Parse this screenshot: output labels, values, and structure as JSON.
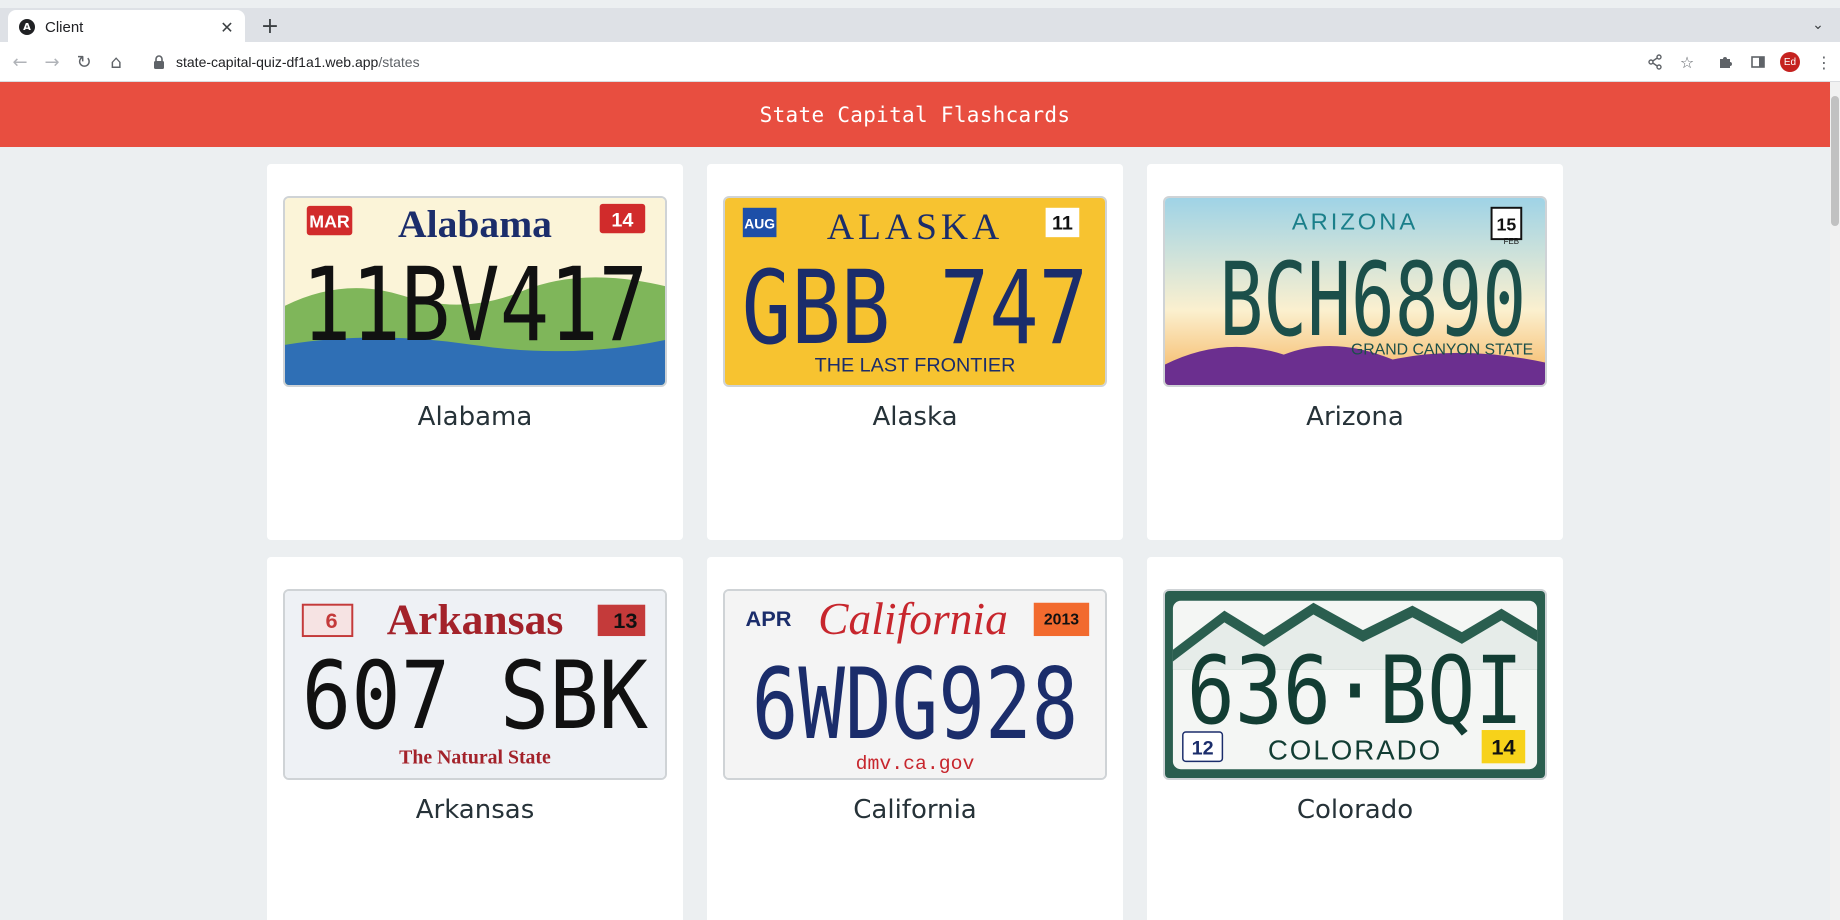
{
  "browser": {
    "tab_title": "Client",
    "url_host": "state-capital-quiz-df1a1.web.app",
    "url_path": "/states",
    "profile_initials": "Ed"
  },
  "app": {
    "title": "State Capital Flashcards",
    "accent_color": "#e84e40"
  },
  "states": [
    {
      "name": "Alabama",
      "plate": {
        "header": "Alabama",
        "number": "11BV417",
        "month": "MAR",
        "year": "14",
        "footer": ""
      }
    },
    {
      "name": "Alaska",
      "plate": {
        "header": "ALASKA",
        "number": "GBB 747",
        "month": "AUG",
        "year": "11",
        "footer": "THE LAST FRONTIER"
      }
    },
    {
      "name": "Arizona",
      "plate": {
        "header": "ARIZONA",
        "number": "BCH6890",
        "month": "FEB",
        "year": "15",
        "footer": "GRAND CANYON STATE"
      }
    },
    {
      "name": "Arkansas",
      "plate": {
        "header": "Arkansas",
        "number": "607 SBK",
        "month": "6",
        "year": "13",
        "footer": "The Natural State"
      }
    },
    {
      "name": "California",
      "plate": {
        "header": "California",
        "number": "6WDG928",
        "month": "APR",
        "year": "2013",
        "footer": "dmv.ca.gov"
      }
    },
    {
      "name": "Colorado",
      "plate": {
        "header": "",
        "number": "636·BQI",
        "month": "12",
        "year": "14",
        "footer": "COLORADO"
      }
    }
  ]
}
